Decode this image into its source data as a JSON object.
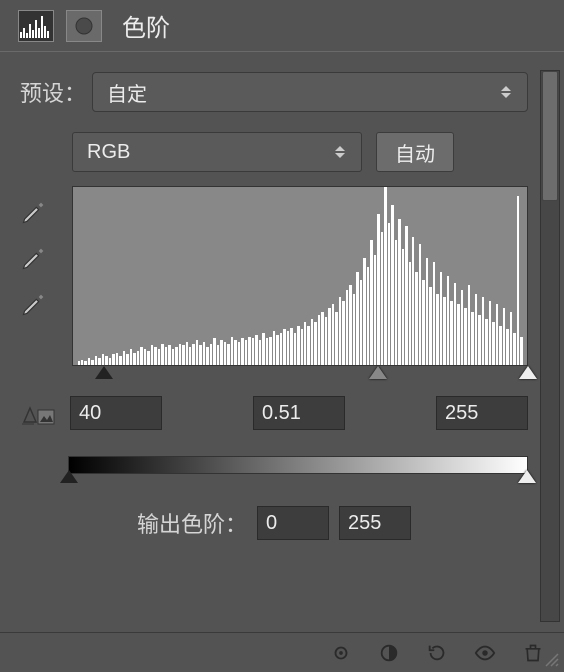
{
  "header": {
    "title": "色阶",
    "icon1": "histogram-icon",
    "icon2": "mask-icon"
  },
  "preset": {
    "label": "预设：",
    "value": "自定"
  },
  "channel": {
    "value": "RGB"
  },
  "auto_button": "自动",
  "eyedroppers": [
    "black-point",
    "gray-point",
    "white-point"
  ],
  "input_levels": {
    "black": "40",
    "mid": "0.51",
    "white": "255"
  },
  "output_levels": {
    "label": "输出色阶：",
    "black": "0",
    "white": "255"
  },
  "chart_data": {
    "type": "bar",
    "title": "Histogram",
    "xlabel": "",
    "ylabel": "",
    "xlim": [
      0,
      255
    ],
    "ylim": [
      0,
      100
    ],
    "values": [
      2,
      3,
      2,
      4,
      3,
      5,
      4,
      6,
      5,
      4,
      6,
      7,
      5,
      8,
      6,
      9,
      7,
      8,
      10,
      9,
      8,
      11,
      10,
      9,
      12,
      10,
      11,
      9,
      10,
      12,
      11,
      13,
      10,
      12,
      14,
      11,
      13,
      10,
      12,
      15,
      11,
      14,
      13,
      12,
      16,
      14,
      13,
      15,
      14,
      16,
      15,
      17,
      14,
      18,
      15,
      16,
      19,
      17,
      18,
      20,
      19,
      21,
      18,
      22,
      20,
      24,
      22,
      26,
      24,
      28,
      30,
      27,
      32,
      34,
      30,
      38,
      36,
      42,
      45,
      40,
      52,
      48,
      60,
      55,
      70,
      62,
      85,
      75,
      100,
      80,
      90,
      70,
      82,
      65,
      78,
      58,
      72,
      52,
      68,
      48,
      60,
      44,
      58,
      40,
      52,
      38,
      50,
      36,
      46,
      34,
      42,
      32,
      45,
      30,
      40,
      28,
      38,
      26,
      36,
      24,
      34,
      22,
      32,
      20,
      30,
      18,
      95,
      16
    ]
  },
  "slider_positions": {
    "black": 7,
    "mid": 67,
    "white": 100
  },
  "footer_icons": [
    "link-icon",
    "adjustment-icon",
    "reset-icon",
    "eye-icon",
    "trash-icon"
  ]
}
